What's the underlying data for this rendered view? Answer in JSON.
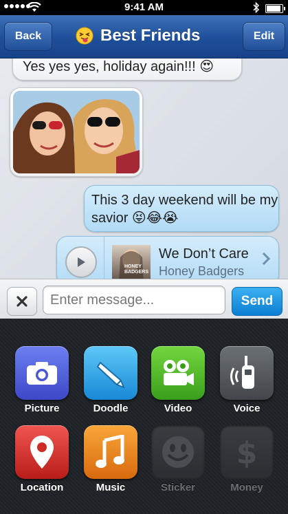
{
  "status_bar": {
    "time": "9:41 AM"
  },
  "nav": {
    "back_label": "Back",
    "title": "Best Friends",
    "edit_label": "Edit"
  },
  "messages": {
    "first_text": "Yes yes yes, holiday again!!! 😍",
    "photo": "photo of two smiling friends in sunglasses",
    "outgoing_text": "This 3 day weekend will be my savior 😝😂😭",
    "song": {
      "title": "We Don’t Care",
      "artist": "Honey Badgers",
      "album_art_text": "HONEY BADGERS"
    }
  },
  "compose": {
    "placeholder": "Enter message...",
    "send_label": "Send"
  },
  "attachments": [
    {
      "label": "Picture",
      "icon": "camera-icon"
    },
    {
      "label": "Doodle",
      "icon": "pencil-icon"
    },
    {
      "label": "Video",
      "icon": "video-camera-icon"
    },
    {
      "label": "Voice",
      "icon": "walkie-talkie-icon"
    },
    {
      "label": "Location",
      "icon": "map-pin-icon"
    },
    {
      "label": "Music",
      "icon": "music-note-icon"
    },
    {
      "label": "Sticker",
      "icon": "smiley-icon",
      "disabled": true
    },
    {
      "label": "Money",
      "icon": "dollar-icon",
      "disabled": true
    }
  ]
}
